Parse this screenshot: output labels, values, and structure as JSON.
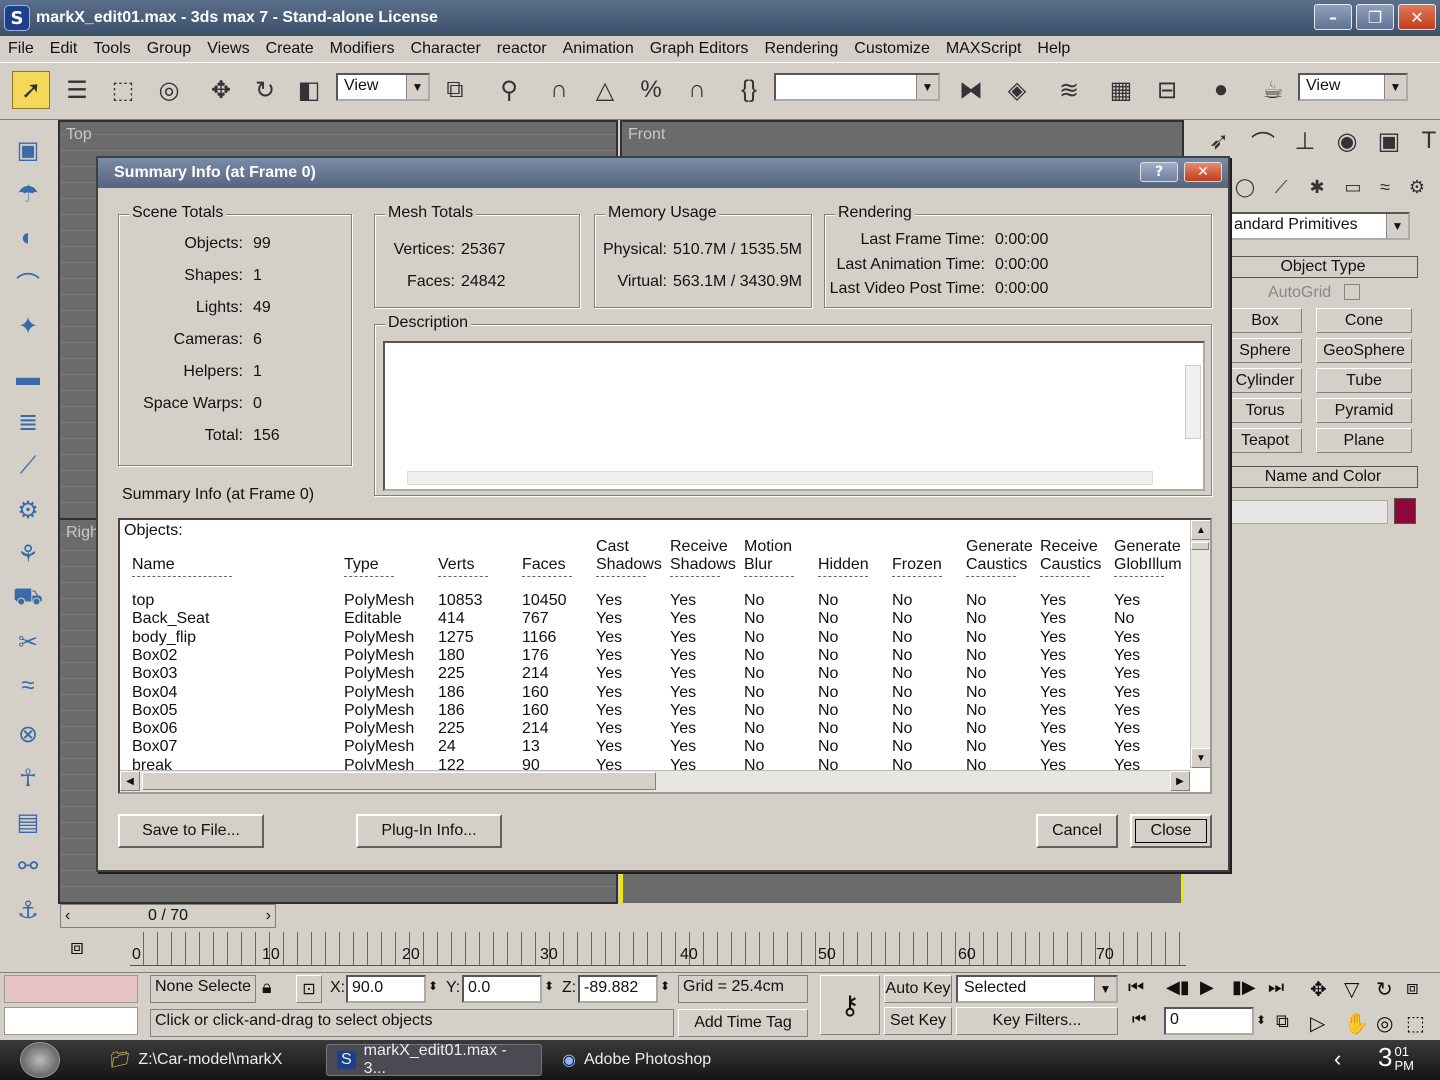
{
  "window": {
    "title": "markX_edit01.max - 3ds max 7  - Stand-alone License",
    "minimize": "–",
    "maximize": "❐",
    "close": "✕"
  },
  "menu": [
    "File",
    "Edit",
    "Tools",
    "Group",
    "Views",
    "Create",
    "Modifiers",
    "Character",
    "reactor",
    "Animation",
    "Graph Editors",
    "Rendering",
    "Customize",
    "MAXScript",
    "Help"
  ],
  "toolbar": {
    "view_combo": "View",
    "view_combo_right": "View",
    "named_selection": ""
  },
  "viewports": {
    "top": "Top",
    "front": "Front",
    "right": "Righ"
  },
  "command_panel": {
    "category": "andard Primitives",
    "object_type": "Object Type",
    "autogrid": "AutoGrid",
    "buttons": [
      "Box",
      "Cone",
      "Sphere",
      "GeoSphere",
      "Cylinder",
      "Tube",
      "Torus",
      "Pyramid",
      "Teapot",
      "Plane"
    ],
    "name_and_color": "Name and Color",
    "color": "#8b0a3a"
  },
  "dialog": {
    "title": "Summary Info (at Frame 0)",
    "help": "?",
    "close": "✕",
    "scene_totals": {
      "label": "Scene Totals",
      "rows": [
        {
          "label": "Objects:",
          "value": "99"
        },
        {
          "label": "Shapes:",
          "value": "1"
        },
        {
          "label": "Lights:",
          "value": "49"
        },
        {
          "label": "Cameras:",
          "value": "6"
        },
        {
          "label": "Helpers:",
          "value": "1"
        },
        {
          "label": "Space Warps:",
          "value": "0"
        },
        {
          "label": "Total:",
          "value": "156"
        }
      ]
    },
    "mesh_totals": {
      "label": "Mesh Totals",
      "rows": [
        {
          "label": "Vertices:",
          "value": "25367"
        },
        {
          "label": "Faces:",
          "value": "24842"
        }
      ]
    },
    "memory_usage": {
      "label": "Memory Usage",
      "rows": [
        {
          "label": "Physical:",
          "value": "510.7M / 1535.5M"
        },
        {
          "label": "Virtual:",
          "value": "563.1M / 3430.9M"
        }
      ]
    },
    "rendering": {
      "label": "Rendering",
      "rows": [
        {
          "label": "Last Frame Time:",
          "value": "0:00:00"
        },
        {
          "label": "Last Animation Time:",
          "value": "0:00:00"
        },
        {
          "label": "Last Video Post Time:",
          "value": "0:00:00"
        }
      ]
    },
    "description_label": "Description",
    "summary_label": "Summary Info (at Frame 0)",
    "objects_label": "Objects:",
    "columns": [
      {
        "top": "",
        "bottom": "Name"
      },
      {
        "top": "",
        "bottom": "Type"
      },
      {
        "top": "",
        "bottom": "Verts"
      },
      {
        "top": "",
        "bottom": "Faces"
      },
      {
        "top": "Cast",
        "bottom": "Shadows"
      },
      {
        "top": "Receive",
        "bottom": "Shadows"
      },
      {
        "top": "Motion",
        "bottom": "Blur"
      },
      {
        "top": "",
        "bottom": "Hidden"
      },
      {
        "top": "",
        "bottom": "Frozen"
      },
      {
        "top": "Generate",
        "bottom": "Caustics"
      },
      {
        "top": "Receive",
        "bottom": "Caustics"
      },
      {
        "top": "Generate",
        "bottom": "GlobIllum"
      }
    ],
    "rows": [
      [
        "top",
        "PolyMesh",
        "10853",
        "10450",
        "Yes",
        "Yes",
        "No",
        "No",
        "No",
        "No",
        "Yes",
        "Yes"
      ],
      [
        "Back_Seat",
        "Editable",
        "414",
        "767",
        "Yes",
        "Yes",
        "No",
        "No",
        "No",
        "No",
        "Yes",
        "No"
      ],
      [
        "body_flip",
        "PolyMesh",
        "1275",
        "1166",
        "Yes",
        "Yes",
        "No",
        "No",
        "No",
        "No",
        "Yes",
        "Yes"
      ],
      [
        "Box02",
        "PolyMesh",
        "180",
        "176",
        "Yes",
        "Yes",
        "No",
        "No",
        "No",
        "No",
        "Yes",
        "Yes"
      ],
      [
        "Box03",
        "PolyMesh",
        "225",
        "214",
        "Yes",
        "Yes",
        "No",
        "No",
        "No",
        "No",
        "Yes",
        "Yes"
      ],
      [
        "Box04",
        "PolyMesh",
        "186",
        "160",
        "Yes",
        "Yes",
        "No",
        "No",
        "No",
        "No",
        "Yes",
        "Yes"
      ],
      [
        "Box05",
        "PolyMesh",
        "186",
        "160",
        "Yes",
        "Yes",
        "No",
        "No",
        "No",
        "No",
        "Yes",
        "Yes"
      ],
      [
        "Box06",
        "PolyMesh",
        "225",
        "214",
        "Yes",
        "Yes",
        "No",
        "No",
        "No",
        "No",
        "Yes",
        "Yes"
      ],
      [
        "Box07",
        "PolyMesh",
        "24",
        "13",
        "Yes",
        "Yes",
        "No",
        "No",
        "No",
        "No",
        "Yes",
        "Yes"
      ],
      [
        "break",
        "PolyMesh",
        "122",
        "90",
        "Yes",
        "Yes",
        "No",
        "No",
        "No",
        "No",
        "Yes",
        "Yes"
      ]
    ],
    "buttons": {
      "save": "Save to File...",
      "plugin": "Plug-In Info...",
      "cancel": "Cancel",
      "close": "Close"
    }
  },
  "timeline": {
    "frame": "0 / 70",
    "ticks": [
      "0",
      "10",
      "20",
      "30",
      "40",
      "50",
      "60",
      "70"
    ]
  },
  "status": {
    "selection": "None Selecte",
    "x_label": "X:",
    "x": "90.0",
    "y_label": "Y:",
    "y": "0.0",
    "z_label": "Z:",
    "z": "-89.882",
    "grid": "Grid = 25.4cm",
    "auto_key": "Auto Key",
    "set_key": "Set Key",
    "key_mode": "Selected",
    "key_filters": "Key Filters...",
    "frame_field": "0",
    "prompt": "Click or click-and-drag to select objects",
    "add_time_tag": "Add Time Tag"
  },
  "taskbar": {
    "items": [
      "Z:\\Car-model\\markX",
      "markX_edit01.max - 3...",
      "Adobe Photoshop"
    ],
    "clock_top": "3",
    "clock_min": "01",
    "clock_ampm": "PM"
  }
}
